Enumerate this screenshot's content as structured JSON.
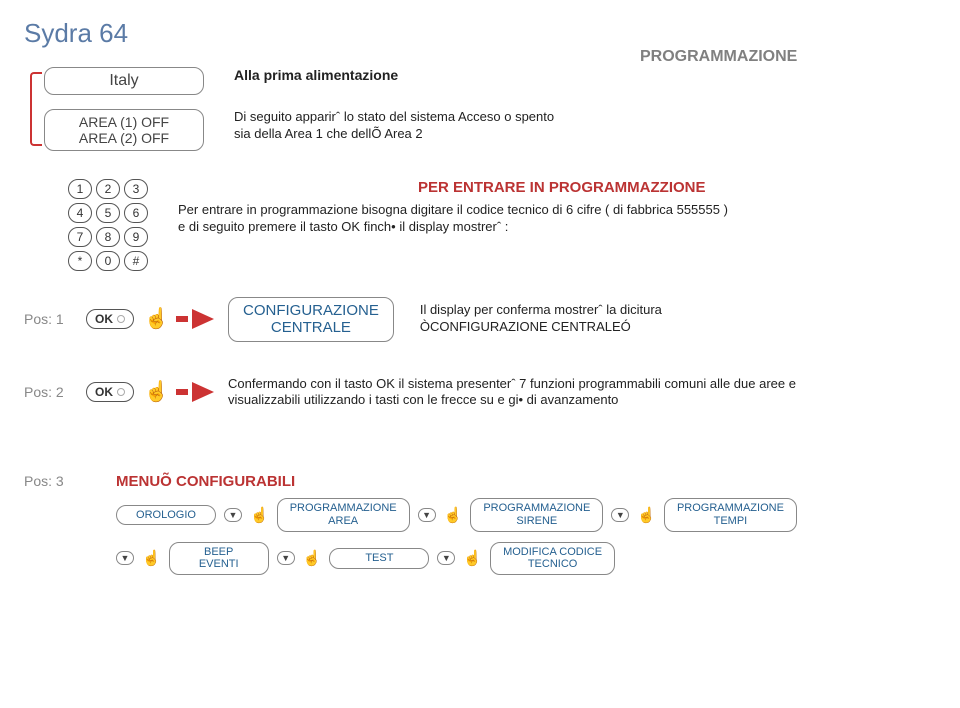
{
  "title": "Sydra 64",
  "heading": "PROGRAMMAZIONE",
  "row1": {
    "lcd": "Italy",
    "subhead": "Alla prima alimentazione"
  },
  "row1b": {
    "lcd_line1": "AREA (1)  OFF",
    "lcd_line2": "AREA (2)  OFF",
    "text_line1": "Di seguito apparirˆ lo stato del sistema Acceso o spento",
    "text_line2": "sia della Area 1 che  dellÕ Area 2"
  },
  "keypad": [
    "1",
    "2",
    "3",
    "4",
    "5",
    "6",
    "7",
    "8",
    "9",
    "*",
    "0",
    "#"
  ],
  "row2": {
    "red_title": "PER ENTRARE IN PROGRAMMAZZIONE",
    "line1": "Per entrare in programmazione bisogna digitare il codice tecnico di 6 cifre ( di fabbrica  555555 )",
    "line2": "e di seguito premere il tasto OK finch•  il display mostrerˆ :"
  },
  "pos1": {
    "label": "Pos: 1",
    "ok": "OK",
    "lcd_line1": "CONFIGURAZIONE",
    "lcd_line2": "CENTRALE",
    "text_line1": "Il display per conferma mostrerˆ la dicitura",
    "text_line2": "ÒCONFIGURAZIONE CENTRALEÓ"
  },
  "pos2": {
    "label": "Pos: 2",
    "ok": "OK",
    "text_line1": "Confermando con il tasto OK il sistema presenterˆ 7 funzioni programmabili comuni alle due aree e",
    "text_line2": "visualizzabili utilizzando i tasti con le frecce  su e gi•  di avanzamento"
  },
  "pos3": {
    "label": "Pos: 3",
    "menu_title": "MENUÕ CONFIGURABILI",
    "items": [
      {
        "l1": "OROLOGIO",
        "l2": ""
      },
      {
        "l1": "PROGRAMMAZIONE",
        "l2": "AREA"
      },
      {
        "l1": "PROGRAMMAZIONE",
        "l2": "SIRENE"
      },
      {
        "l1": "PROGRAMMAZIONE",
        "l2": "TEMPI"
      },
      {
        "l1": "BEEP",
        "l2": "EVENTI"
      },
      {
        "l1": "TEST",
        "l2": ""
      },
      {
        "l1": "MODIFICA CODICE",
        "l2": "TECNICO"
      }
    ]
  }
}
